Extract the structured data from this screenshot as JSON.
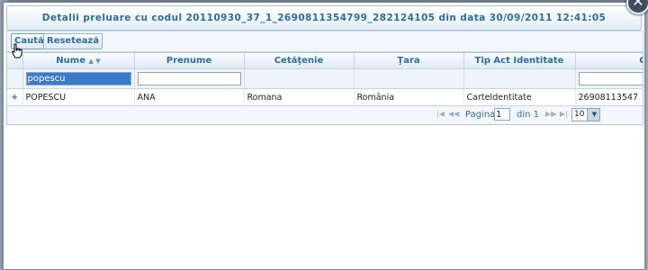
{
  "dialog": {
    "title": "Detalii preluare cu codul 20110930_37_1_2690811354799_282124105 din data 30/09/2011 12:41:05",
    "close_glyph": "✕"
  },
  "toolbar": {
    "search_label": "Caută",
    "reset_label": "Resetează"
  },
  "grid": {
    "columns": [
      {
        "label": "Nume",
        "sort_glyph": "▲ ▼"
      },
      {
        "label": "Prenume"
      },
      {
        "label": "Cetăţenie"
      },
      {
        "label": "Ţara"
      },
      {
        "label": "Tip Act Identitate"
      },
      {
        "label": "CNP/ Nr C"
      }
    ],
    "filters": {
      "nume": "popescu",
      "prenume": "",
      "cetatenie": "",
      "tara": "",
      "tip_act": "",
      "cnp": ""
    },
    "rows": [
      {
        "expand": "+",
        "nume": "POPESCU",
        "prenume": "ANA",
        "cetatenie": "Romana",
        "tara": "România",
        "tip_act": "CarteIdentitate",
        "cnp": "26908113547"
      }
    ]
  },
  "pager": {
    "first_glyph": "|◀",
    "prev_glyph": "◀◀",
    "page_label": "Pagina",
    "page_value": "1",
    "of_label": "din 1",
    "next_glyph": "▶▶",
    "last_glyph": "▶|",
    "rows_per_page": "10",
    "dropdown_glyph": "▼"
  },
  "icons": {
    "cursor": "hand-cursor-icon",
    "close": "close-icon",
    "expand": "plus-icon"
  }
}
